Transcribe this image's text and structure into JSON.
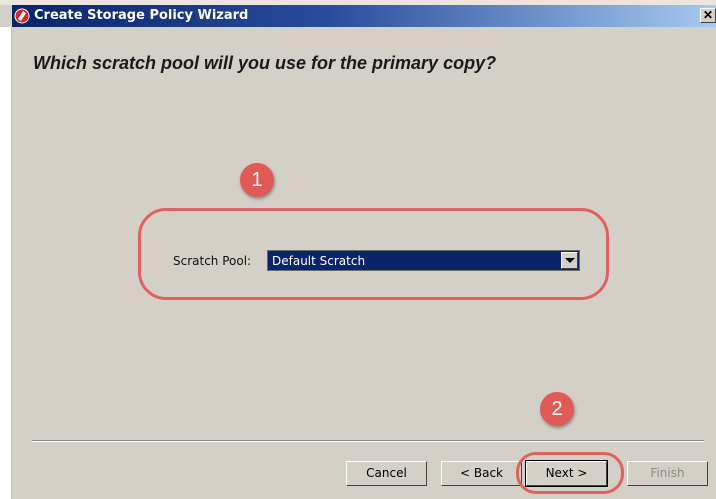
{
  "window": {
    "title": "Create Storage Policy Wizard",
    "close_glyph": "✕",
    "app_icon": "wizard-app-icon"
  },
  "page": {
    "question": "Which scratch pool will you use for the primary copy?"
  },
  "scratch_pool": {
    "label": "Scratch Pool:",
    "selected_value": "Default Scratch"
  },
  "annotations": {
    "step1": "1",
    "step2": "2",
    "color": "#e05a56"
  },
  "buttons": {
    "cancel": "Cancel",
    "back": "< Back",
    "next": "Next >",
    "finish": "Finish"
  },
  "colors": {
    "titlebar": "#0a246a",
    "dialog_bg": "#d4d0c8",
    "selection": "#0a246a"
  }
}
